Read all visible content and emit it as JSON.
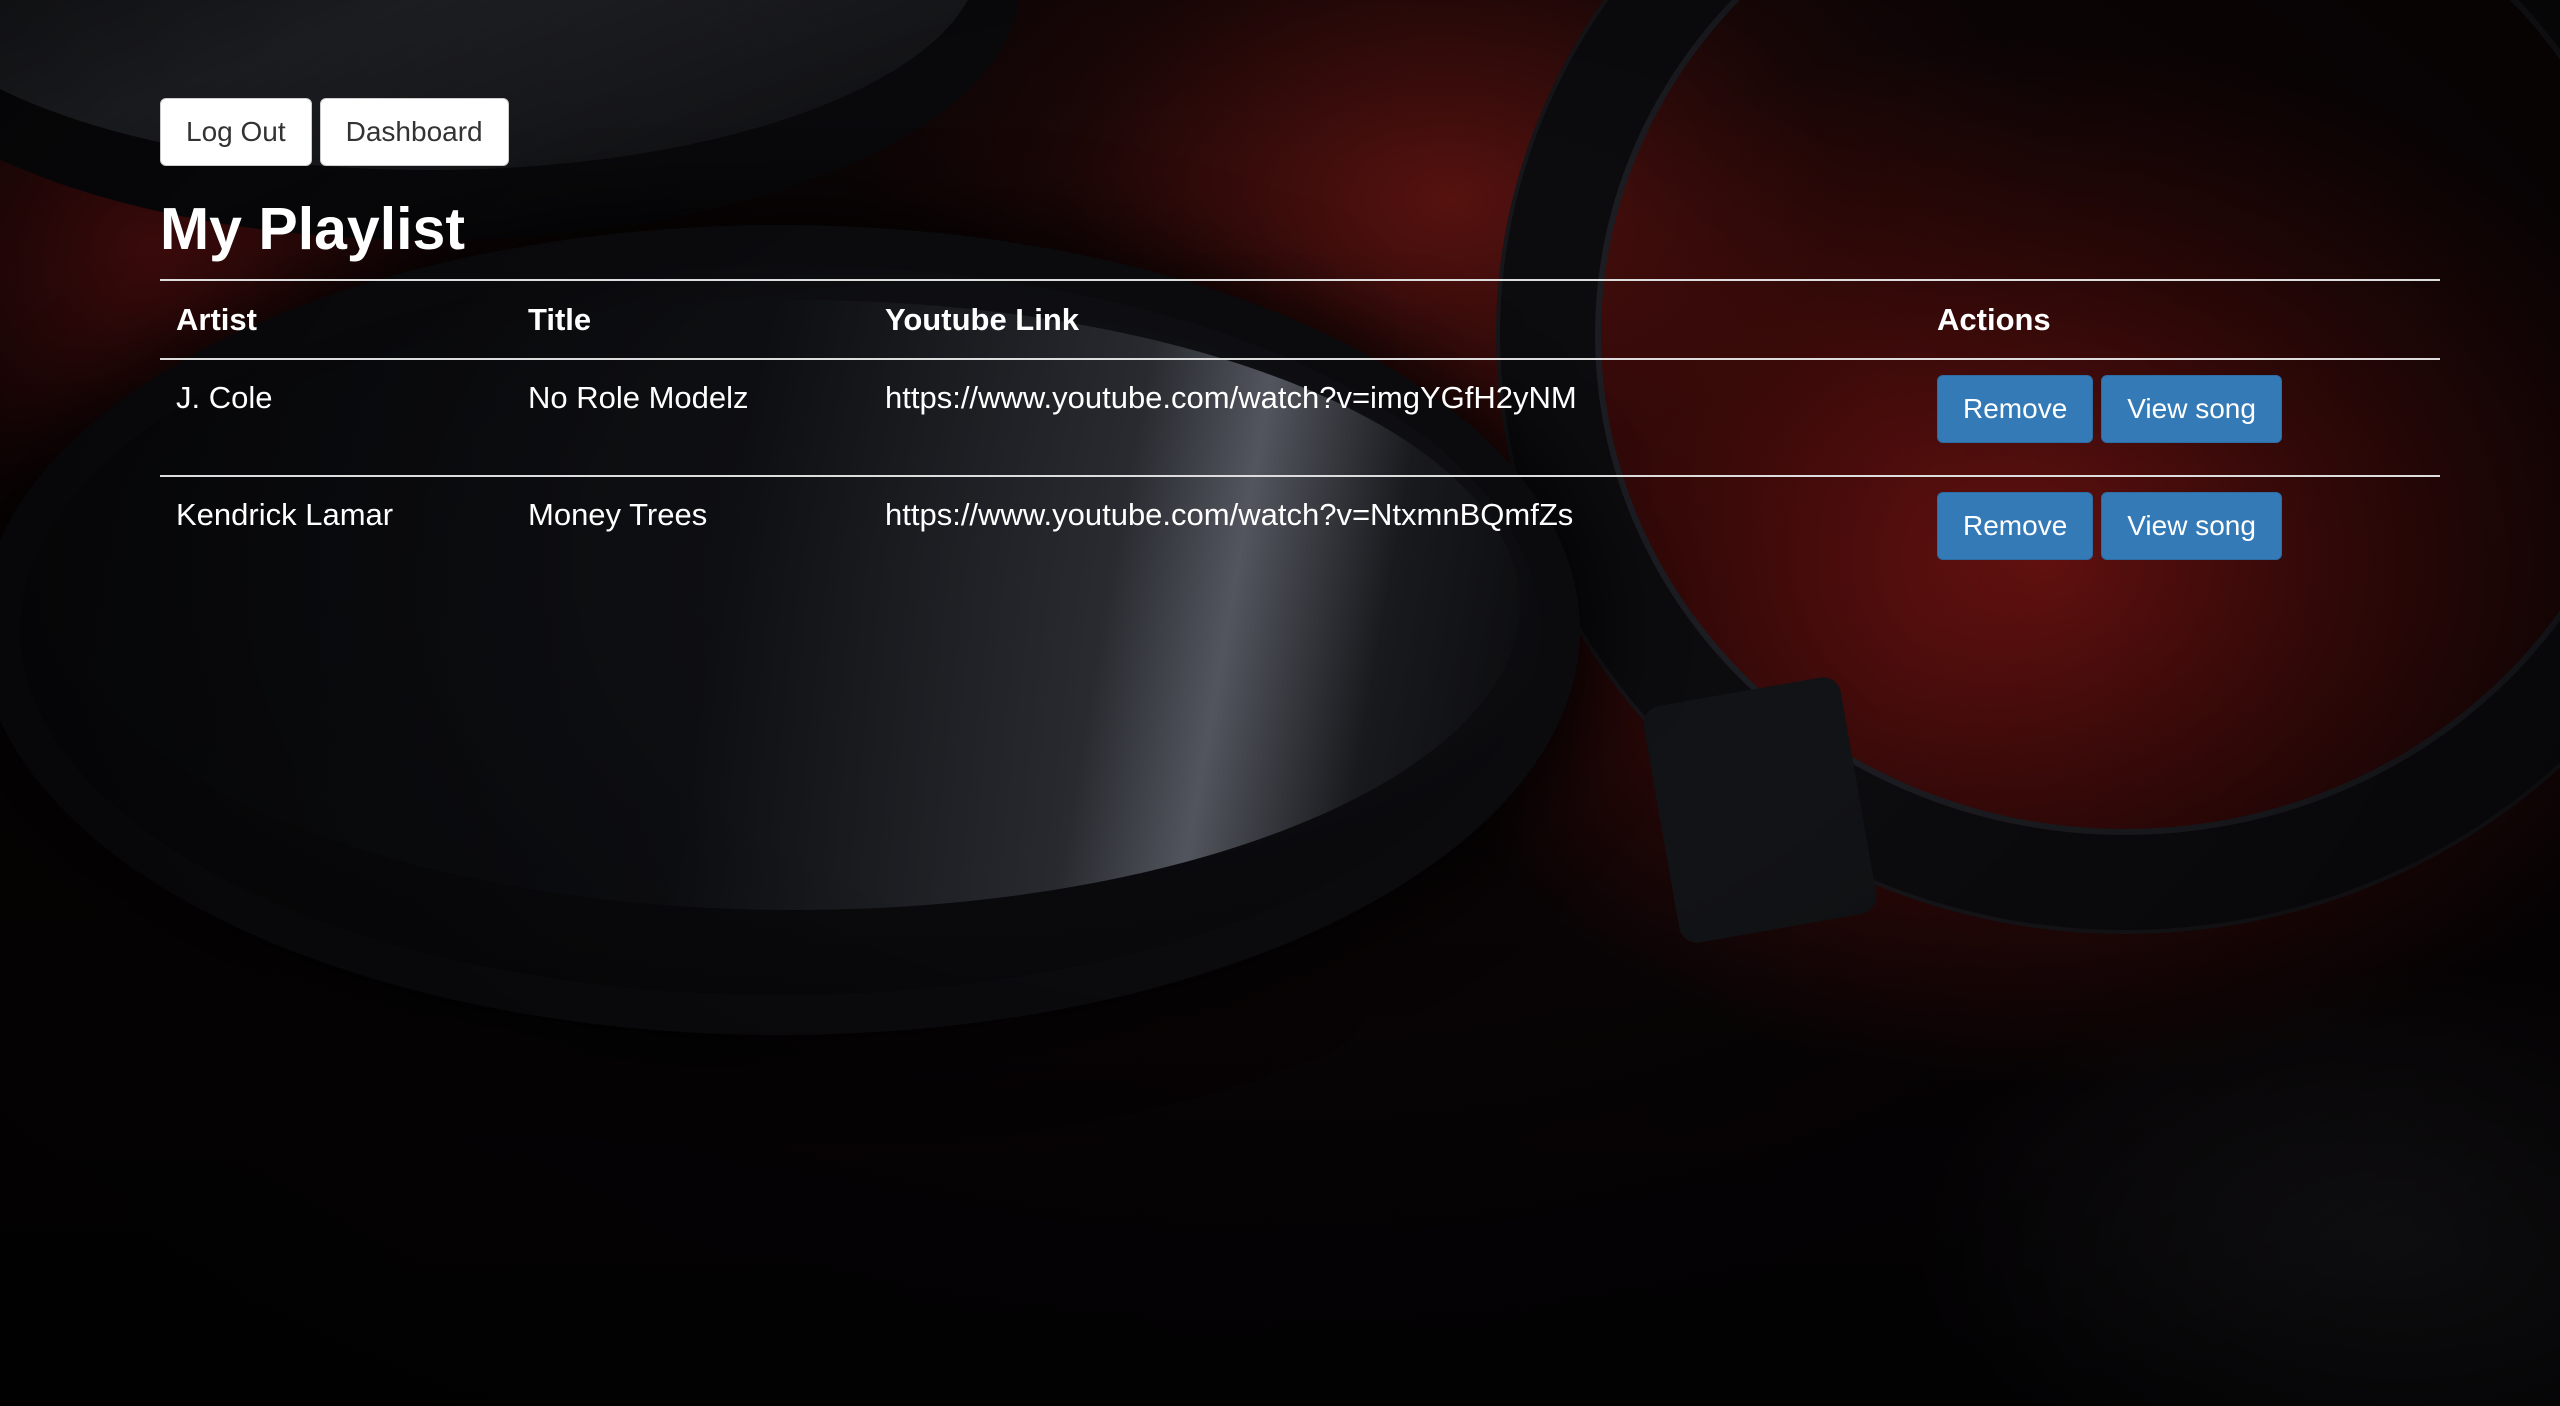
{
  "nav": {
    "logout_label": "Log Out",
    "dashboard_label": "Dashboard"
  },
  "page": {
    "title": "My Playlist"
  },
  "table": {
    "headers": {
      "artist": "Artist",
      "title": "Title",
      "link": "Youtube Link",
      "actions": "Actions"
    },
    "rows": [
      {
        "artist": "J. Cole",
        "title": "No Role Modelz",
        "link": "https://www.youtube.com/watch?v=imgYGfH2yNM",
        "remove_label": "Remove",
        "view_label": "View song"
      },
      {
        "artist": "Kendrick Lamar",
        "title": "Money Trees",
        "link": "https://www.youtube.com/watch?v=NtxmnBQmfZs",
        "remove_label": "Remove",
        "view_label": "View song"
      }
    ]
  },
  "colors": {
    "primary_button": "#337ab7",
    "default_button": "#ffffff",
    "text": "#ffffff",
    "divider": "#dddddd"
  }
}
